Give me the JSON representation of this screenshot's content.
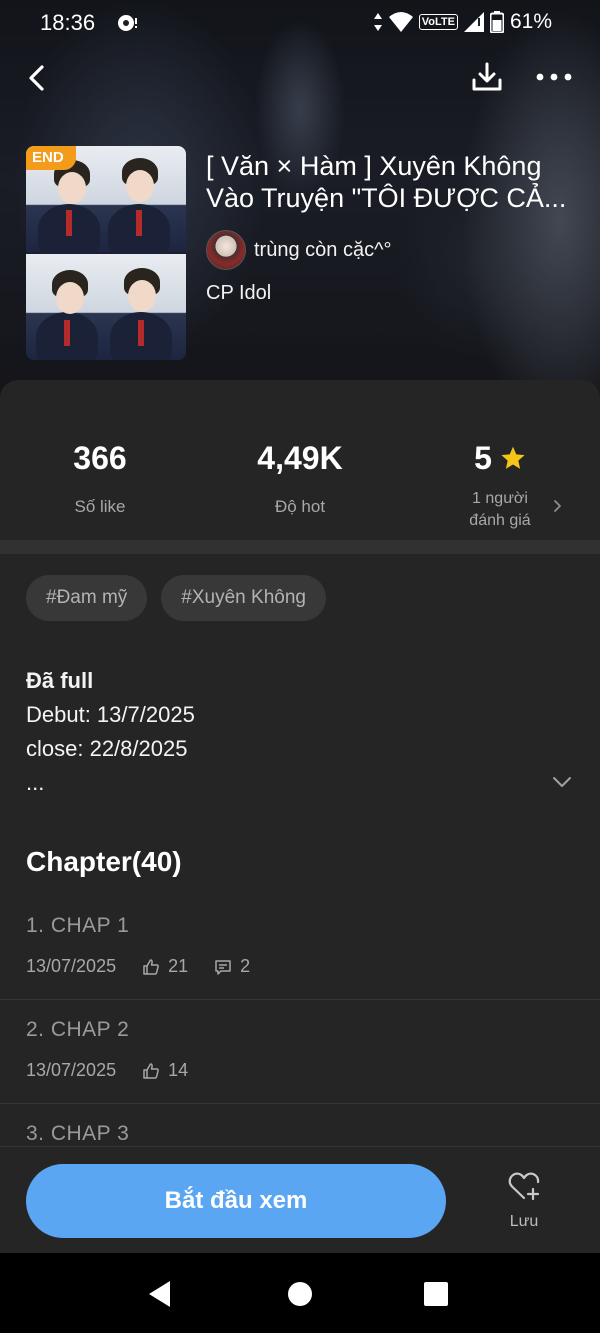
{
  "status_bar": {
    "time": "18:36",
    "network": "VoLTE",
    "battery": "61%"
  },
  "story": {
    "badge": "END",
    "title": "[ Văn × Hàm ] Xuyên Không Vào Truyện \"TÔI ĐƯỢC CẢ...",
    "author": "trùng còn cặc^°",
    "category": "CP Idol"
  },
  "stats": {
    "likes_value": "366",
    "likes_label": "Số like",
    "hot_value": "4,49K",
    "hot_label": "Độ hot",
    "rating_value": "5",
    "rating_label_1": "1 người",
    "rating_label_2": "đánh giá"
  },
  "tags": [
    "#Đam mỹ",
    "#Xuyên Không"
  ],
  "description": {
    "line1": "Đã full",
    "line2": "Debut: 13/7/2025",
    "line3": "close: 22/8/2025",
    "line4": "..."
  },
  "chapters": {
    "heading": "Chapter(40)",
    "items": [
      {
        "title": "1. CHAP 1",
        "date": "13/07/2025",
        "likes": "21",
        "comments": "2"
      },
      {
        "title": "2. CHAP 2",
        "date": "13/07/2025",
        "likes": "14"
      },
      {
        "title": "3. CHAP 3"
      }
    ]
  },
  "bottom": {
    "start_label": "Bắt đầu xem",
    "save_label": "Lưu"
  },
  "colors": {
    "accent": "#5aa6f3",
    "badge": "#f39b1b",
    "star": "#f5c518",
    "sheet": "#252525"
  }
}
